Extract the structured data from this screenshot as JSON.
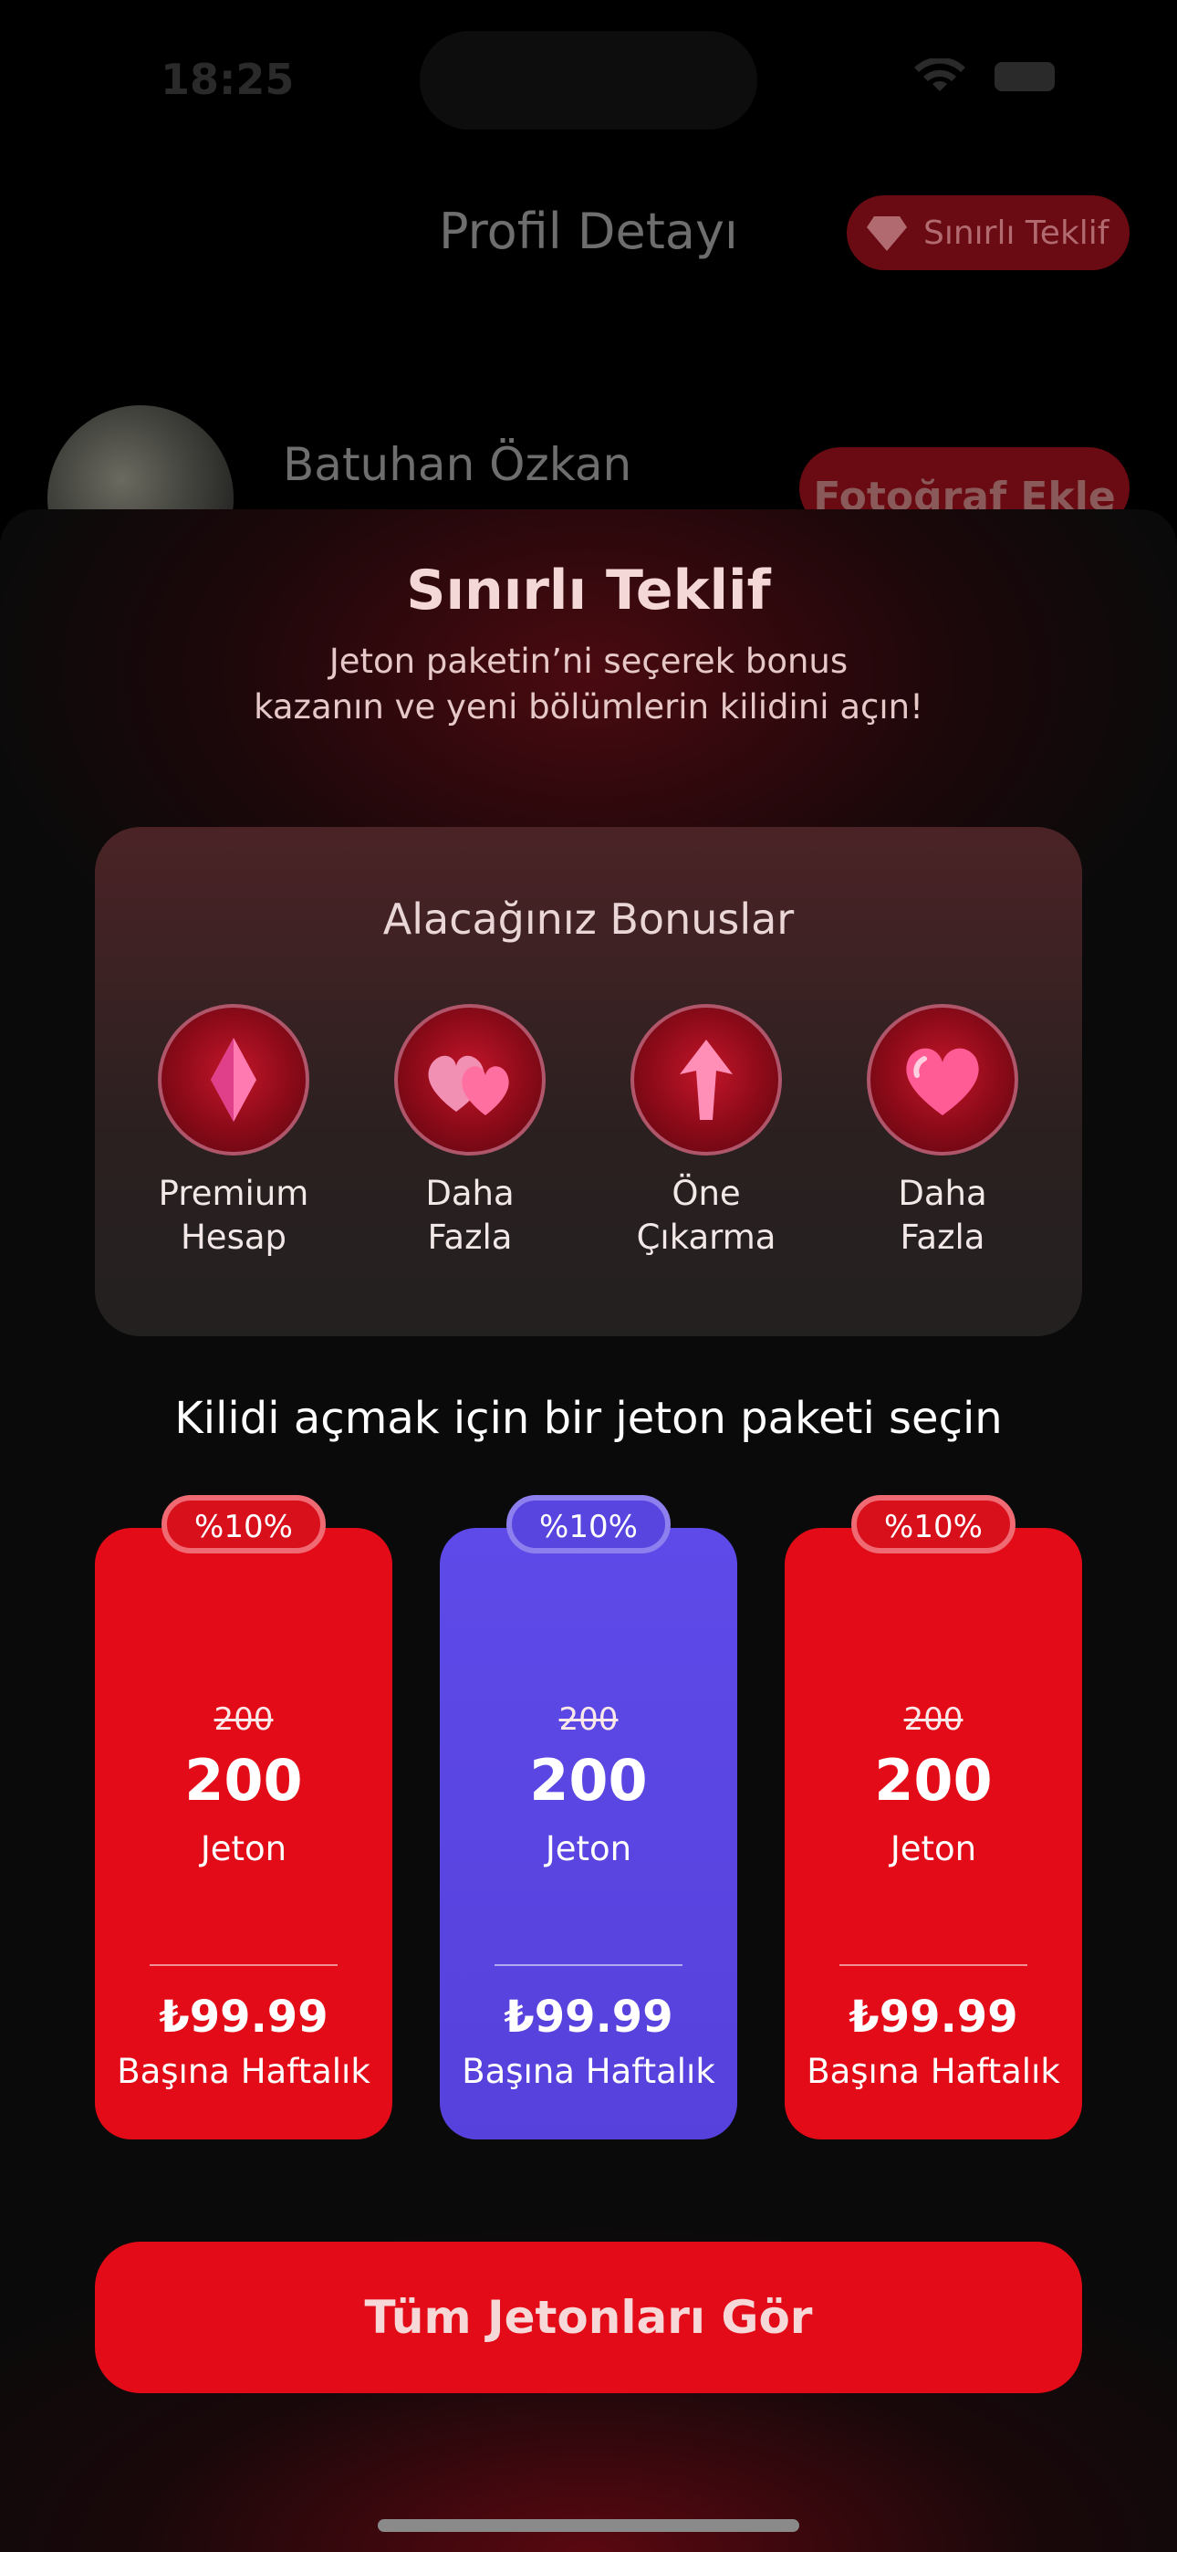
{
  "status": {
    "time": "18:25"
  },
  "header": {
    "title": "Profil Detayı",
    "offer_label": "Sınırlı Teklif"
  },
  "profile": {
    "name": "Batuhan Özkan",
    "add_photo_label": "Fotoğraf Ekle"
  },
  "sheet": {
    "title": "Sınırlı Teklif",
    "subtitle": "Jeton paketin’ni seçerek bonus\nkazanın ve yeni bölümlerin kilidini açın!"
  },
  "bonuses": {
    "title": "Alacağınız Bonuslar",
    "items": [
      {
        "label": "Premium\nHesap",
        "icon": "diamond-icon"
      },
      {
        "label": "Daha\nFazla",
        "icon": "hearts-icon"
      },
      {
        "label": "Öne\nÇıkarma",
        "icon": "boost-arrow-icon"
      },
      {
        "label": "Daha\nFazla",
        "icon": "heart-icon"
      }
    ]
  },
  "packages": {
    "title": "Kilidi açmak için bir jeton paketi seçin",
    "items": [
      {
        "badge": "%10%",
        "old_amount": "200",
        "amount": "200",
        "unit": "Jeton",
        "price": "₺99.99",
        "period": "Başına Haftalık",
        "color": "#e30b17",
        "selected": false
      },
      {
        "badge": "%10%",
        "old_amount": "200",
        "amount": "200",
        "unit": "Jeton",
        "price": "₺99.99",
        "period": "Başına Haftalık",
        "color": "#5a46e4",
        "selected": true
      },
      {
        "badge": "%10%",
        "old_amount": "200",
        "amount": "200",
        "unit": "Jeton",
        "price": "₺99.99",
        "period": "Başına Haftalık",
        "color": "#e30b17",
        "selected": false
      }
    ]
  },
  "cta": {
    "label": "Tüm Jetonları Gör"
  },
  "colors": {
    "accent": "#e30b17",
    "selected": "#5a46e4",
    "background": "#000000"
  }
}
